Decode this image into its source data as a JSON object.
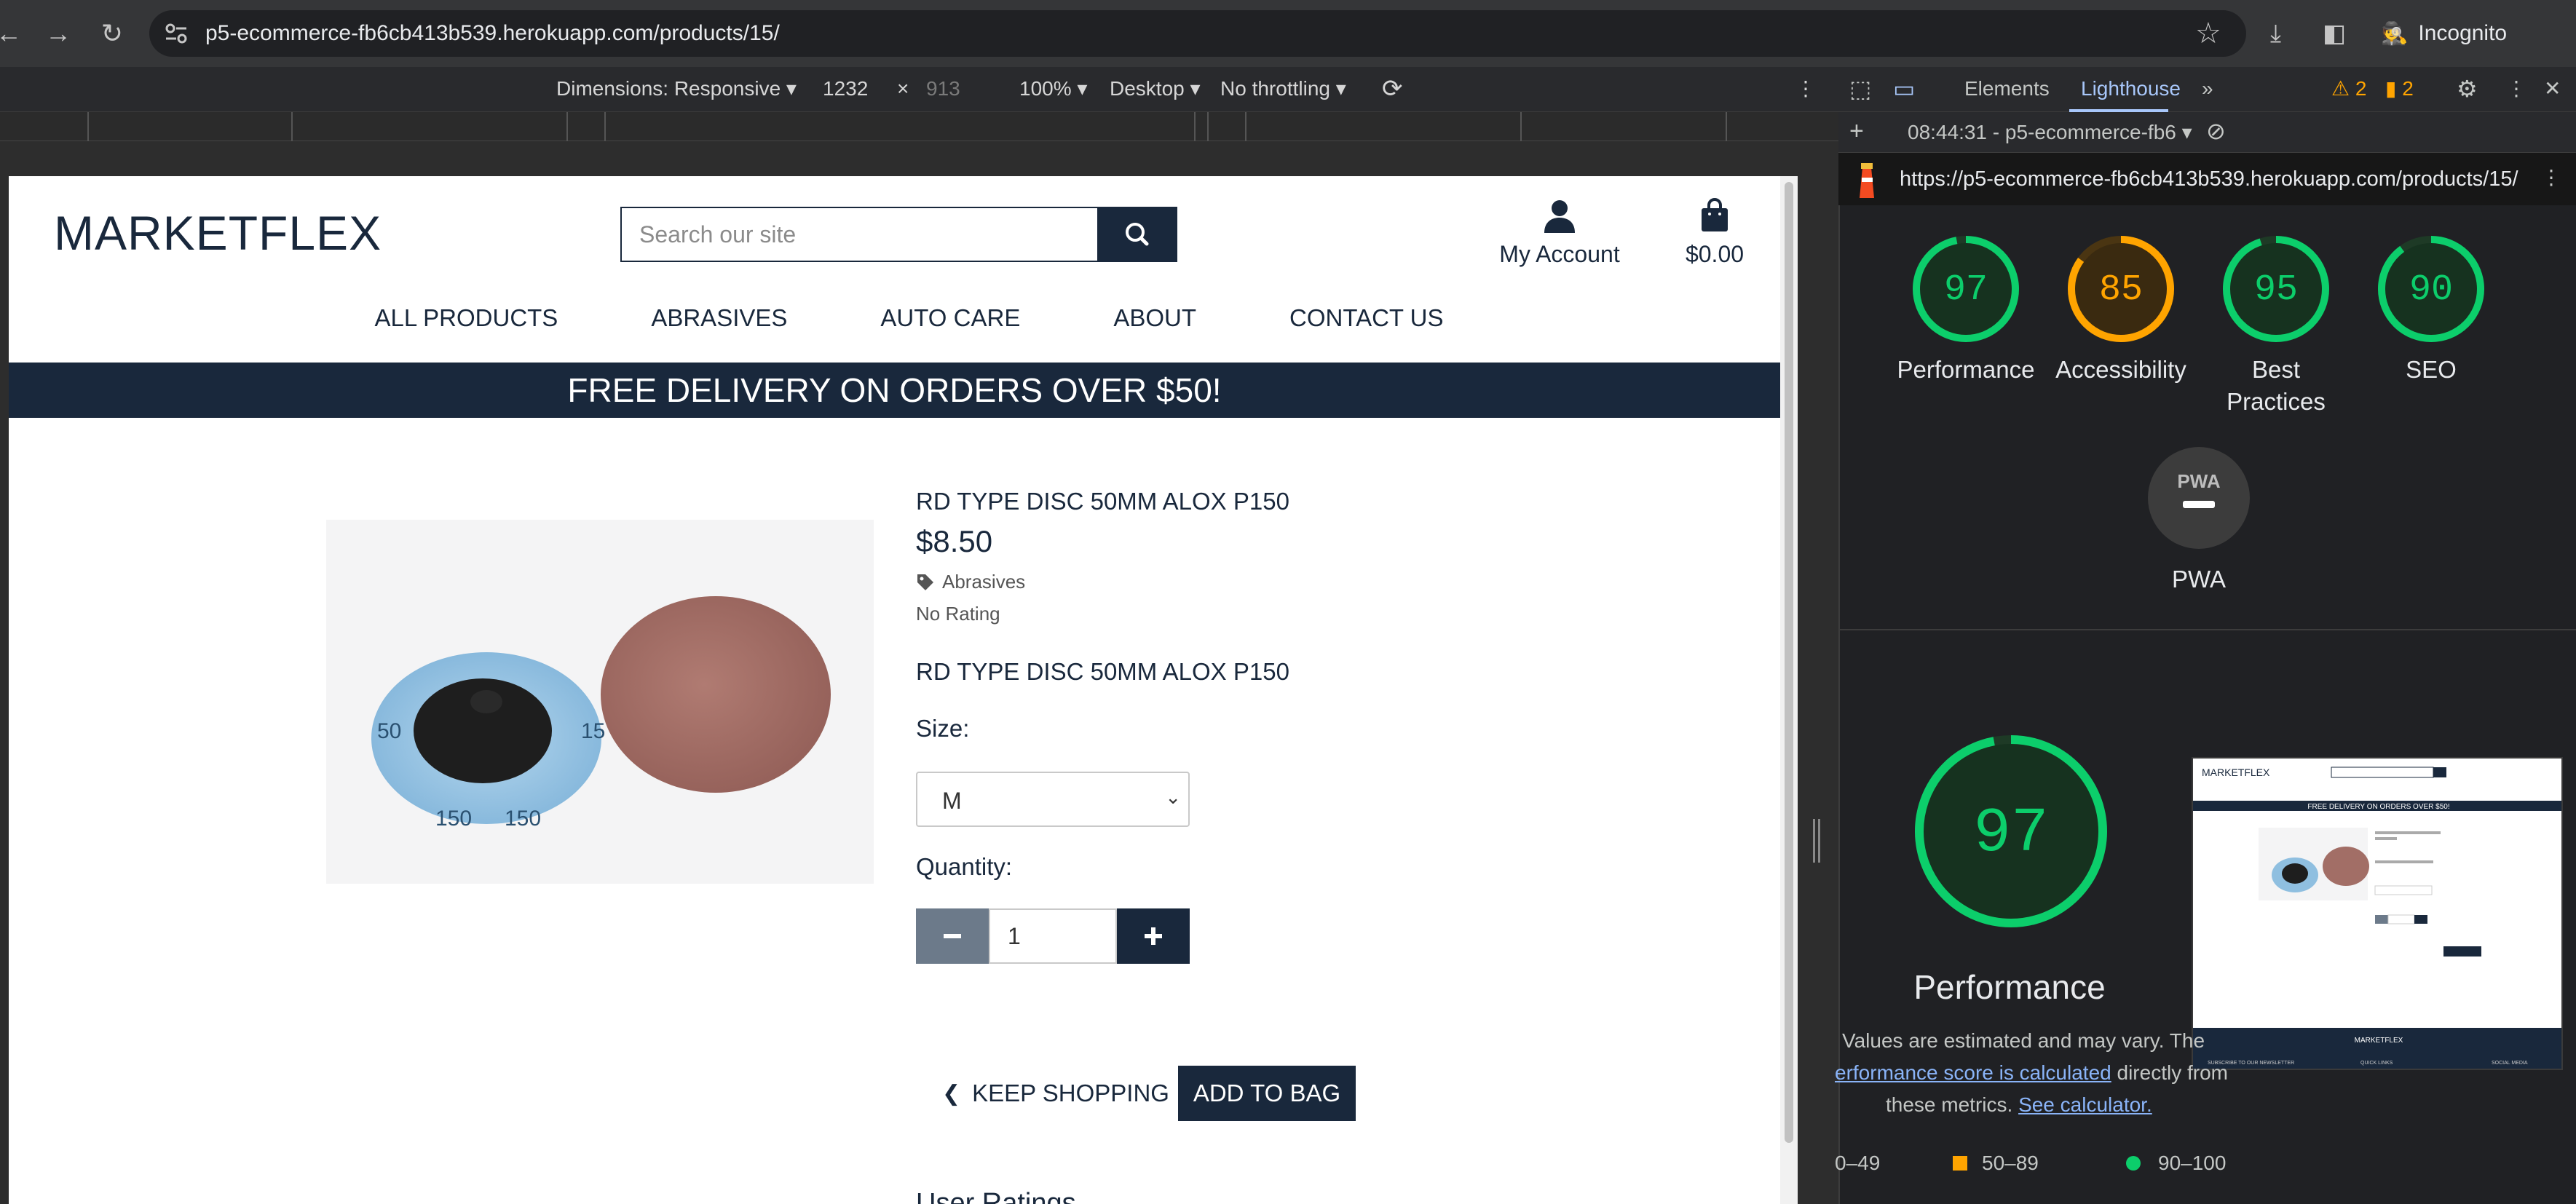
{
  "browser": {
    "url": "p5-ecommerce-fb6cb413b539.herokuapp.com/products/15/",
    "profile_label": "Incognito"
  },
  "device_toolbar": {
    "dimensions": "Dimensions: Responsive",
    "width": "1232",
    "height": "913",
    "zoom": "100%",
    "device": "Desktop",
    "throttling": "No throttling"
  },
  "site": {
    "logo": "MARKETFLEX",
    "search_placeholder": "Search our site",
    "account_label": "My Account",
    "bag_total": "$0.00",
    "nav": [
      "ALL PRODUCTS",
      "ABRASIVES",
      "AUTO CARE",
      "ABOUT",
      "CONTACT US"
    ],
    "banner": "FREE DELIVERY ON ORDERS OVER $50!"
  },
  "product": {
    "name": "RD TYPE DISC 50MM ALOX P150",
    "price": "$8.50",
    "category": "Abrasives",
    "rating": "No Rating",
    "description": "RD TYPE DISC 50MM ALOX P150",
    "size_label": "Size:",
    "size_value": "M",
    "quantity_label": "Quantity:",
    "quantity_value": "1",
    "keep_shopping": "KEEP SHOPPING",
    "add_to_bag": "ADD TO BAG",
    "next_heading": "User Ratings",
    "image_labels": [
      "150",
      "150",
      "50",
      "15"
    ]
  },
  "devtools": {
    "tabs": [
      "Elements",
      "Lighthouse"
    ],
    "active_tab": "Lighthouse",
    "warnings": "2",
    "errors": "2",
    "report_select": "08:44:31 - p5-ecommerce-fb6",
    "report_url": "https://p5-ecommerce-fb6cb413b539.herokuapp.com/products/15/",
    "scores": [
      {
        "label": "Performance",
        "value": 97,
        "color": "#0cce6b"
      },
      {
        "label": "Accessibility",
        "value": 85,
        "color": "#ffa400"
      },
      {
        "label": "Best Practices",
        "value": 95,
        "color": "#0cce6b"
      },
      {
        "label": "SEO",
        "value": 90,
        "color": "#0cce6b"
      }
    ],
    "pwa_label": "PWA",
    "pwa_badge": "PWA",
    "big_score": 97,
    "big_label": "Performance",
    "note_line1": "Values are estimated and may vary. The",
    "note_link1": "erformance score is calculated",
    "note_line2_tail": "directly from",
    "note_line3": "these metrics.",
    "note_link2": "See calculator.",
    "legend": [
      "0–49",
      "50–89",
      "90–100"
    ],
    "legend_colors": [
      "#ff4e42",
      "#ffa400",
      "#0cce6b"
    ]
  },
  "thumbnail": {
    "logo": "MARKETFLEX",
    "banner": "FREE DELIVERY ON ORDERS OVER $50!",
    "footer_brand": "MARKETFLEX",
    "footer_cols": [
      "SUBSCRIBE TO OUR NEWSLETTER",
      "QUICK LINKS",
      "SOCIAL MEDIA"
    ]
  }
}
